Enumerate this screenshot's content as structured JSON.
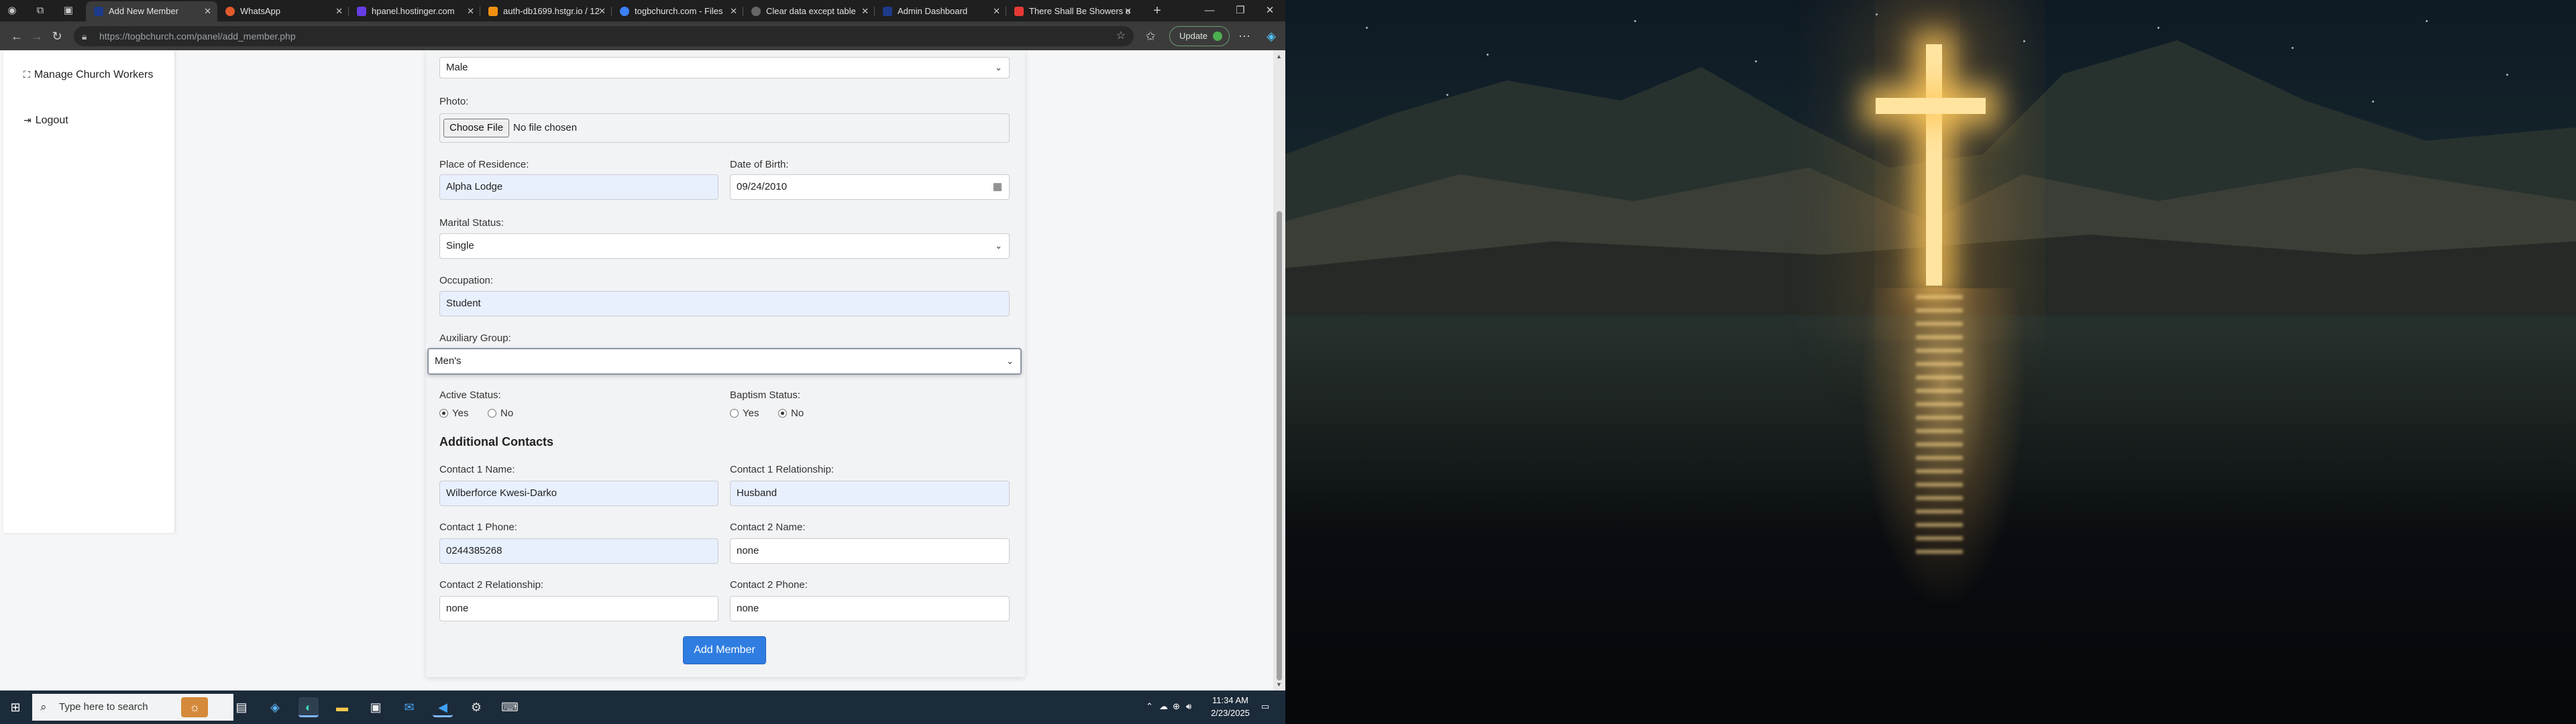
{
  "browser": {
    "tabs": [
      {
        "title": "Add New Member",
        "active": true,
        "favicon_color": "#1e3a8a"
      },
      {
        "title": "WhatsApp",
        "active": false,
        "favicon_color": "#e05a2b"
      },
      {
        "title": "hpanel.hostinger.com",
        "active": false,
        "favicon_color": "#673de6"
      },
      {
        "title": "auth-db1699.hstgr.io / 12",
        "active": false,
        "favicon_color": "#f29111"
      },
      {
        "title": "togbchurch.com - Files",
        "active": false,
        "favicon_color": "#3b82f6"
      },
      {
        "title": "Clear data except table",
        "active": false,
        "favicon_color": "#666666"
      },
      {
        "title": "Admin Dashboard",
        "active": false,
        "favicon_color": "#1e3a8a"
      },
      {
        "title": "There Shall Be Showers o",
        "active": false,
        "favicon_color": "#e53935"
      }
    ],
    "new_tab": "+",
    "url": "https://togbchurch.com/panel/add_member.php",
    "update_label": "Update"
  },
  "sidebar": {
    "items": [
      {
        "label": "Manage Church Workers",
        "icon": "sitemap-icon"
      },
      {
        "label": "Logout",
        "icon": "logout-icon"
      }
    ]
  },
  "form": {
    "gender": {
      "value": "Male"
    },
    "photo": {
      "label": "Photo:",
      "button": "Choose File",
      "status": "No file chosen"
    },
    "residence": {
      "label": "Place of Residence:",
      "value": "Alpha Lodge"
    },
    "dob": {
      "label": "Date of Birth:",
      "value": "09/24/2010"
    },
    "marital": {
      "label": "Marital Status:",
      "value": "Single"
    },
    "occupation": {
      "label": "Occupation:",
      "value": "Student"
    },
    "auxiliary": {
      "label": "Auxiliary Group:",
      "value": "Men's"
    },
    "active_status": {
      "label": "Active Status:",
      "options": [
        "Yes",
        "No"
      ],
      "selected": "Yes"
    },
    "baptism_status": {
      "label": "Baptism Status:",
      "options": [
        "Yes",
        "No"
      ],
      "selected": "No"
    },
    "additional_heading": "Additional Contacts",
    "c1_name": {
      "label": "Contact 1 Name:",
      "value": "Wilberforce Kwesi-Darko"
    },
    "c1_rel": {
      "label": "Contact 1 Relationship:",
      "value": "Husband"
    },
    "c1_phone": {
      "label": "Contact 1 Phone:",
      "value": "0244385268"
    },
    "c2_name": {
      "label": "Contact 2 Name:",
      "value": "none"
    },
    "c2_rel": {
      "label": "Contact 2 Relationship:",
      "value": "none"
    },
    "c2_phone": {
      "label": "Contact 2 Phone:",
      "value": "none"
    },
    "submit_label": "Add Member"
  },
  "taskbar": {
    "search_placeholder": "Type here to search",
    "time": "11:34 AM",
    "date": "2/23/2025"
  }
}
